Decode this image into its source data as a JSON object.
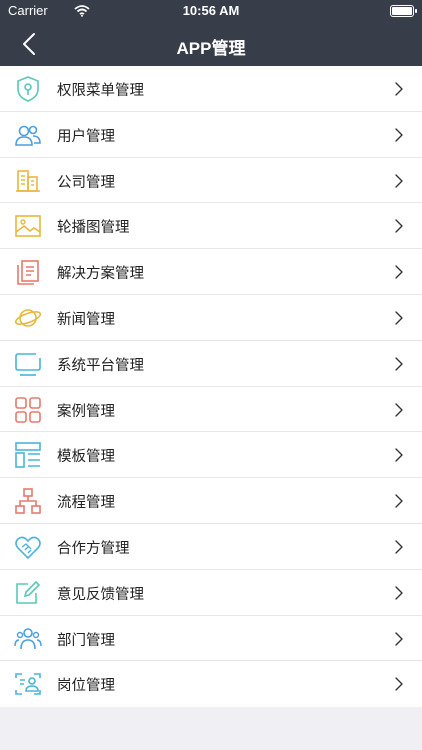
{
  "status_bar": {
    "carrier": "Carrier",
    "time": "10:56 AM"
  },
  "nav": {
    "title": "APP管理"
  },
  "items": [
    {
      "label": "权限菜单管理",
      "icon": "shield-icon",
      "color": "#5cc8b5"
    },
    {
      "label": "用户管理",
      "icon": "users-icon",
      "color": "#4a9fe0"
    },
    {
      "label": "公司管理",
      "icon": "buildings-icon",
      "color": "#e8b83a"
    },
    {
      "label": "轮播图管理",
      "icon": "image-icon",
      "color": "#e8b83a"
    },
    {
      "label": "解决方案管理",
      "icon": "documents-icon",
      "color": "#e77a6a"
    },
    {
      "label": "新闻管理",
      "icon": "planet-icon",
      "color": "#e8b83a"
    },
    {
      "label": "系统平台管理",
      "icon": "monitor-icon",
      "color": "#4ab5d8"
    },
    {
      "label": "案例管理",
      "icon": "grid-icon",
      "color": "#e77a6a"
    },
    {
      "label": "模板管理",
      "icon": "template-icon",
      "color": "#4ab5d8"
    },
    {
      "label": "流程管理",
      "icon": "flowchart-icon",
      "color": "#e77a6a"
    },
    {
      "label": "合作方管理",
      "icon": "handshake-heart-icon",
      "color": "#4ab5d8"
    },
    {
      "label": "意见反馈管理",
      "icon": "edit-icon",
      "color": "#5cc8b5"
    },
    {
      "label": "部门管理",
      "icon": "team-icon",
      "color": "#4a9fe0"
    },
    {
      "label": "岗位管理",
      "icon": "id-card-icon",
      "color": "#4ab5d8"
    }
  ]
}
